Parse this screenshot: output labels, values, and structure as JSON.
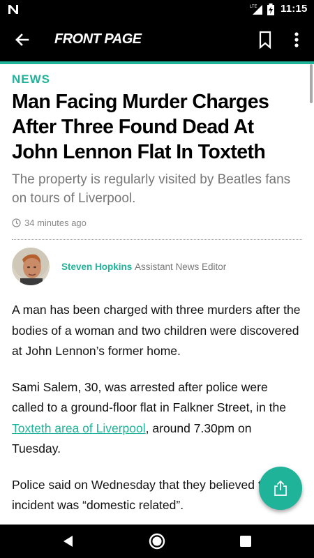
{
  "statusbar": {
    "time": "11:15",
    "network": "LTE"
  },
  "appbar": {
    "title": "FRONT PAGE"
  },
  "article": {
    "section": "NEWS",
    "headline": "Man Facing Murder Charges After Three Found Dead At John Lennon Flat In Toxteth",
    "subheadline": "The property is regularly visited by Beatles fans on tours of Liverpool.",
    "timestamp": "34 minutes ago",
    "author": {
      "name": "Steven Hopkins",
      "role": "Assistant News Editor"
    },
    "paragraphs": {
      "p1": "A man has been charged with three murders after the bodies of a woman and two children were discovered at John Lennon’s former home.",
      "p2_before": "Sami Salem, 30, was arrested after police were called to a ground-floor flat in Falkner Street, in the ",
      "p2_link": "Toxteth area of Liverpool",
      "p2_after": ", around 7.30pm on Tuesday.",
      "p3": "Police said on Wednesday that they believed the incident was “domestic related”."
    }
  },
  "colors": {
    "accent": "#1fb39a",
    "bar": "#000000"
  },
  "icons": [
    "n-logo-icon",
    "signal-icon",
    "battery-icon",
    "back-arrow-icon",
    "bookmark-icon",
    "more-vert-icon",
    "clock-icon",
    "share-icon",
    "nav-back-icon",
    "nav-home-icon",
    "nav-recents-icon"
  ]
}
